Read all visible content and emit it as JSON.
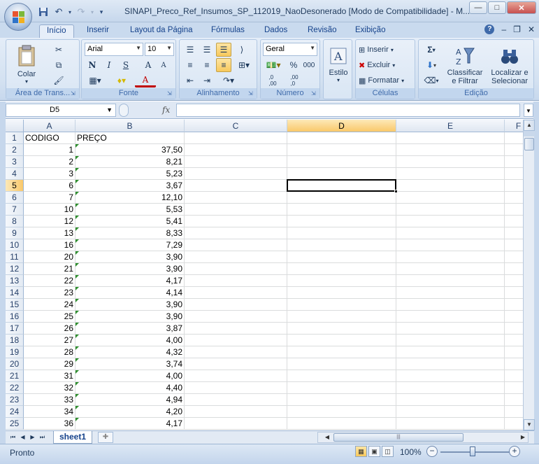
{
  "window": {
    "title": "SINAPI_Preco_Ref_Insumos_SP_112019_NaoDesonerado  [Modo de Compatibilidade] - M...",
    "minimize_label": "—",
    "maximize_label": "□",
    "close_label": "✕"
  },
  "qat": {
    "save_icon": "💾",
    "undo_icon": "↶",
    "redo_icon": "↷",
    "more_icon": "▾"
  },
  "tabs": [
    {
      "label": "Início"
    },
    {
      "label": "Inserir"
    },
    {
      "label": "Layout da Página"
    },
    {
      "label": "Fórmulas"
    },
    {
      "label": "Dados"
    },
    {
      "label": "Revisão"
    },
    {
      "label": "Exibição"
    }
  ],
  "help_ctrls": {
    "help": "?",
    "min": "–",
    "restore": "❐",
    "close": "✕"
  },
  "ribbon": {
    "clipboard": {
      "label": "Área de Trans...",
      "paste": "Colar"
    },
    "font": {
      "label": "Fonte",
      "family": "Arial",
      "size": "10",
      "bold": "N",
      "italic": "I",
      "underline": "S",
      "grow": "A",
      "shrink": "A",
      "fill_letter": "A",
      "font_letter": "A"
    },
    "alignment": {
      "label": "Alinhamento"
    },
    "number": {
      "label": "Número",
      "format": "Geral",
      "percent": "%",
      "thousands": "000",
      "inc_dec": ",0→,00",
      "dec_dec": ",00→,0"
    },
    "styles": {
      "label": "Estilo"
    },
    "cells": {
      "label": "Células",
      "insert": "Inserir",
      "delete": "Excluir",
      "format": "Formatar"
    },
    "editing": {
      "label": "Edição",
      "sort": "Classificar e Filtrar",
      "sort_l1": "Classificar",
      "sort_l2": "e Filtrar",
      "find_l1": "Localizar e",
      "find_l2": "Selecionar",
      "sigma": "Σ"
    }
  },
  "formula_bar": {
    "name_box": "D5",
    "fx": "fx",
    "content": ""
  },
  "grid": {
    "columns": [
      "A",
      "B",
      "C",
      "D",
      "E",
      "F"
    ],
    "selected_column": "D",
    "selected_row": "5",
    "rows": [
      {
        "n": "1",
        "a": "CODIGO",
        "b": "PREÇO"
      },
      {
        "n": "2",
        "a": "1",
        "b": "37,50"
      },
      {
        "n": "3",
        "a": "2",
        "b": "8,21"
      },
      {
        "n": "4",
        "a": "3",
        "b": "5,23"
      },
      {
        "n": "5",
        "a": "6",
        "b": "3,67"
      },
      {
        "n": "6",
        "a": "7",
        "b": "12,10"
      },
      {
        "n": "7",
        "a": "10",
        "b": "5,53"
      },
      {
        "n": "8",
        "a": "12",
        "b": "5,41"
      },
      {
        "n": "9",
        "a": "13",
        "b": "8,33"
      },
      {
        "n": "10",
        "a": "16",
        "b": "7,29"
      },
      {
        "n": "11",
        "a": "20",
        "b": "3,90"
      },
      {
        "n": "12",
        "a": "21",
        "b": "3,90"
      },
      {
        "n": "13",
        "a": "22",
        "b": "4,17"
      },
      {
        "n": "14",
        "a": "23",
        "b": "4,14"
      },
      {
        "n": "15",
        "a": "24",
        "b": "3,90"
      },
      {
        "n": "16",
        "a": "25",
        "b": "3,90"
      },
      {
        "n": "17",
        "a": "26",
        "b": "3,87"
      },
      {
        "n": "18",
        "a": "27",
        "b": "4,00"
      },
      {
        "n": "19",
        "a": "28",
        "b": "4,32"
      },
      {
        "n": "20",
        "a": "29",
        "b": "3,74"
      },
      {
        "n": "21",
        "a": "31",
        "b": "4,00"
      },
      {
        "n": "22",
        "a": "32",
        "b": "4,40"
      },
      {
        "n": "23",
        "a": "33",
        "b": "4,94"
      },
      {
        "n": "24",
        "a": "34",
        "b": "4,20"
      },
      {
        "n": "25",
        "a": "36",
        "b": "4,17"
      }
    ]
  },
  "sheets": [
    {
      "label": "sheet1"
    }
  ],
  "status": {
    "text": "Pronto",
    "zoom": "100%",
    "zoom_minus": "−",
    "zoom_plus": "+"
  },
  "colors": {
    "accent": "#15428b",
    "selection": "#f9c86a",
    "number_tri": "#2f8f2f"
  }
}
